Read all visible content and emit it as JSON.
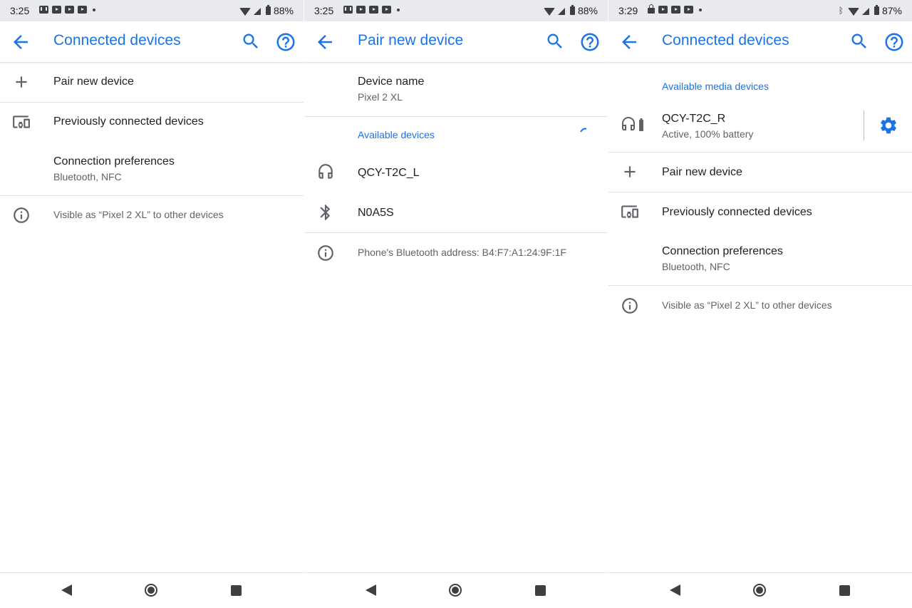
{
  "colors": {
    "accent": "#1a73e8",
    "text_primary": "#202124",
    "text_secondary": "#5f6368",
    "statusbar_bg": "#e8eaed"
  },
  "screen1": {
    "status": {
      "time": "3:25",
      "left_icons": [
        "gmail-icon",
        "youtube-icon",
        "youtube-icon",
        "youtube-icon",
        "dot-icon"
      ],
      "battery": "88%"
    },
    "appbar": {
      "title": "Connected devices"
    },
    "items": [
      {
        "title": "Pair new device",
        "icon": "plus-icon"
      },
      {
        "title": "Previously connected devices",
        "icon": "devices-icon"
      },
      {
        "title": "Connection preferences",
        "subtitle": "Bluetooth, NFC"
      }
    ],
    "info": "Visible as “Pixel 2 XL” to other devices"
  },
  "screen2": {
    "status": {
      "time": "3:25",
      "left_icons": [
        "gmail-icon",
        "youtube-icon",
        "youtube-icon",
        "youtube-icon",
        "dot-icon"
      ],
      "battery": "88%"
    },
    "appbar": {
      "title": "Pair new device"
    },
    "device_name": {
      "title": "Device name",
      "value": "Pixel 2 XL"
    },
    "section_header": "Available devices",
    "devices": [
      {
        "name": "QCY-T2C_L",
        "icon": "headphones-icon"
      },
      {
        "name": "N0A5S",
        "icon": "bluetooth-icon"
      }
    ],
    "info": "Phone's Bluetooth address: B4:F7:A1:24:9F:1F"
  },
  "screen3": {
    "status": {
      "time": "3:29",
      "left_icons": [
        "lock-icon",
        "youtube-icon",
        "youtube-icon",
        "youtube-icon",
        "dot-icon"
      ],
      "battery": "87%"
    },
    "appbar": {
      "title": "Connected devices"
    },
    "section_header": "Available media devices",
    "media_device": {
      "name": "QCY-T2C_R",
      "status": "Active, 100% battery"
    },
    "items": [
      {
        "title": "Pair new device",
        "icon": "plus-icon"
      },
      {
        "title": "Previously connected devices",
        "icon": "devices-icon"
      },
      {
        "title": "Connection preferences",
        "subtitle": "Bluetooth, NFC"
      }
    ],
    "info": "Visible as “Pixel 2 XL” to other devices"
  }
}
